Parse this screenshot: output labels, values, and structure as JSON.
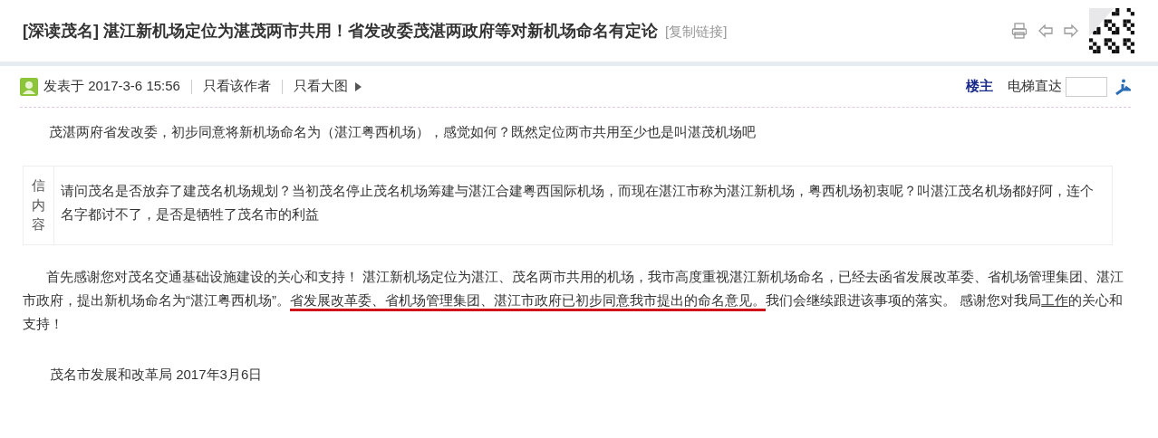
{
  "thread": {
    "title": "[深读茂名] 湛江新机场定位为湛茂两市共用！省发改委茂湛两政府等对新机场命名有定论",
    "copy_link": "[复制链接]"
  },
  "post": {
    "posted": "发表于 2017-3-6 15:56",
    "author_only": "只看该作者",
    "images_only": "只看大图",
    "floor": "楼主",
    "elevator": "电梯直达",
    "body": "茂湛两府省发改委，初步同意将新机场命名为（湛江粤西机场），感觉如何？既然定位两市共用至少也是叫湛茂机场吧",
    "letter": {
      "label": "信内容",
      "text": "请问茂名是否放弃了建茂名机场规划？当初茂名停止茂名机场筹建与湛江合建粤西国际机场，而现在湛江市称为湛江新机场，粤西机场初衷呢？叫湛江茂名机场都好阿，连个名字都讨不了，是否是牺牲了茂名市的利益"
    },
    "reply": [
      {
        "kind": "plain",
        "text": "首先感谢您对茂名交通基础设施建设的关心和支持！ 湛江新机场定位为湛江、茂名两市共用的机场，我市高度重视湛江新机场命名，已经去函省发展改革委、省机场管理集团、湛江市政府，提出新机场命名为“湛江粤西机场”。"
      },
      {
        "kind": "marked",
        "text": "省发展改革委、省机场管理集团、湛江市政府已初步同意我市提出的命名意见。"
      },
      {
        "kind": "plain",
        "text": "我们会继续跟进该事项的落实。 感谢您对我局"
      },
      {
        "kind": "link",
        "text": "工作"
      },
      {
        "kind": "plain",
        "text": "的关心和支持！"
      }
    ],
    "signature": "茂名市发展和改革局 2017年3月6日"
  }
}
